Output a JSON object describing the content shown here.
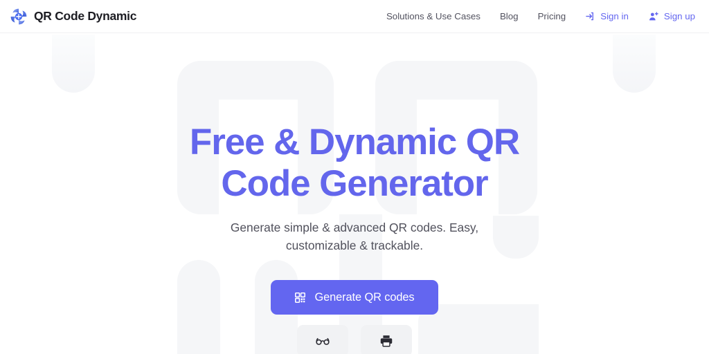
{
  "brand": {
    "name": "QR Code Dynamic",
    "logo_icon": "qr-pinwheel-logo-icon",
    "accent_color": "#6366f0",
    "logo_color_dark": "#3b5bdb",
    "logo_color_light": "#8ea9f5"
  },
  "header": {
    "nav": [
      {
        "label": "Solutions & Use Cases",
        "accent": false,
        "icon": null
      },
      {
        "label": "Blog",
        "accent": false,
        "icon": null
      },
      {
        "label": "Pricing",
        "accent": false,
        "icon": null
      },
      {
        "label": "Sign in",
        "accent": true,
        "icon": "login-icon"
      },
      {
        "label": "Sign up",
        "accent": true,
        "icon": "user-plus-icon"
      }
    ]
  },
  "hero": {
    "title_line_1": "Free & Dynamic QR",
    "title_line_2": "Code Generator",
    "subtitle": "Generate simple & advanced QR codes. Easy, customizable & trackable.",
    "title_color": "#6366ec",
    "cta": {
      "label": "Generate QR codes",
      "icon": "qr-grid-icon",
      "background": "#6366f0",
      "text_color": "#ffffff"
    },
    "tools": [
      {
        "icon": "glasses-icon",
        "name": "scan-qr-code-button"
      },
      {
        "icon": "printer-icon",
        "name": "print-qr-code-button"
      }
    ]
  },
  "background": {
    "page_color": "#ffffff",
    "shape_color": "#f5f6f8"
  }
}
